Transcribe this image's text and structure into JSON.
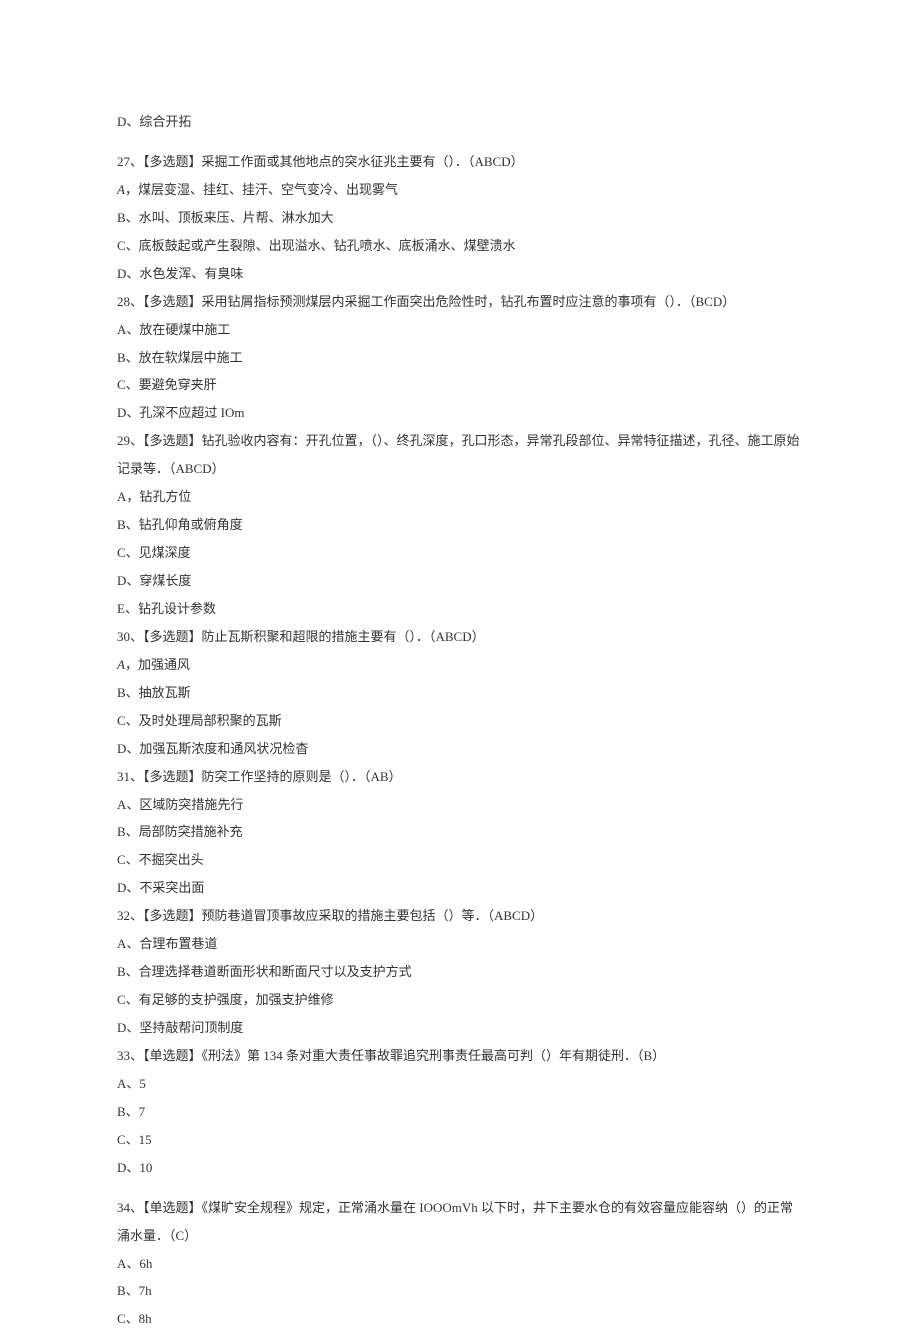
{
  "lines": [
    "D、综合开拓",
    "",
    "27、【多选题】采掘工作面或其他地点的突水征兆主要有（）．（ABCD）",
    "A，煤层变湿、挂红、挂汗、空气变冷、出现雾气",
    "B、水叫、顶板来压、片帮、淋水加大",
    "C、底板鼓起或产生裂隙、出现溢水、钻孔喷水、底板涌水、煤壁溃水",
    "D、水色发浑、有臭味",
    "28、【多选题】采用钻屑指标预测煤层内采掘工作面突出危险性时，钻孔布置时应注意的事项有（）．（BCD）",
    "A、放在硬煤中施工",
    "B、放在软煤层中施工",
    "C、要避免穿夹肝",
    "D、孔深不应超过 IOm",
    "29、【多选题】钻孔验收内容有：开孔位置，（）、终孔深度，孔口形态，异常孔段部位、异常特征描述，孔径、施工原始记录等．（ABCD）",
    "A，钻孔方位",
    "B、钻孔仰角或俯角度",
    "C、见煤深度",
    "D、穿煤长度",
    "E、钻孔设计参数",
    "30、【多选题】防止瓦斯积聚和超限的措施主要有（）．（ABCD）",
    "A，加强通风",
    "B、抽放瓦斯",
    "C、及时处理局部积聚的瓦斯",
    "D、加强瓦斯浓度和通风状况检杳",
    "31、【多选题】防突工作坚持的原则是（）．（AB）",
    "A、区域防突措施先行",
    "B、局部防突措施补充",
    "C、不掘突出头",
    "D、不采突出面",
    "32、【多选题】预防巷道冒顶事故应采取的措施主要包括（）等．（ABCD）",
    "A、合理布置巷道",
    "B、合理选择巷道断面形状和断面尺寸以及支护方式",
    "C、有足够的支护强度，加强支护维修",
    "D、坚持敲帮问顶制度",
    "33、【单选题】《刑法》第 134 条对重大责任事故罪追究刑事责任最高可判（）年有期徒刑．（B）",
    "A、5",
    "B、7",
    "C、15",
    "D、10",
    "",
    "34、【单选题】《煤旷安全规程》规定，正常涌水量在 IOOOmVh 以下时，井下主要水仓的有效容量应能容纳（）的正常涌水量．（C）",
    "A、6h",
    "B、7h",
    "C、8h"
  ]
}
